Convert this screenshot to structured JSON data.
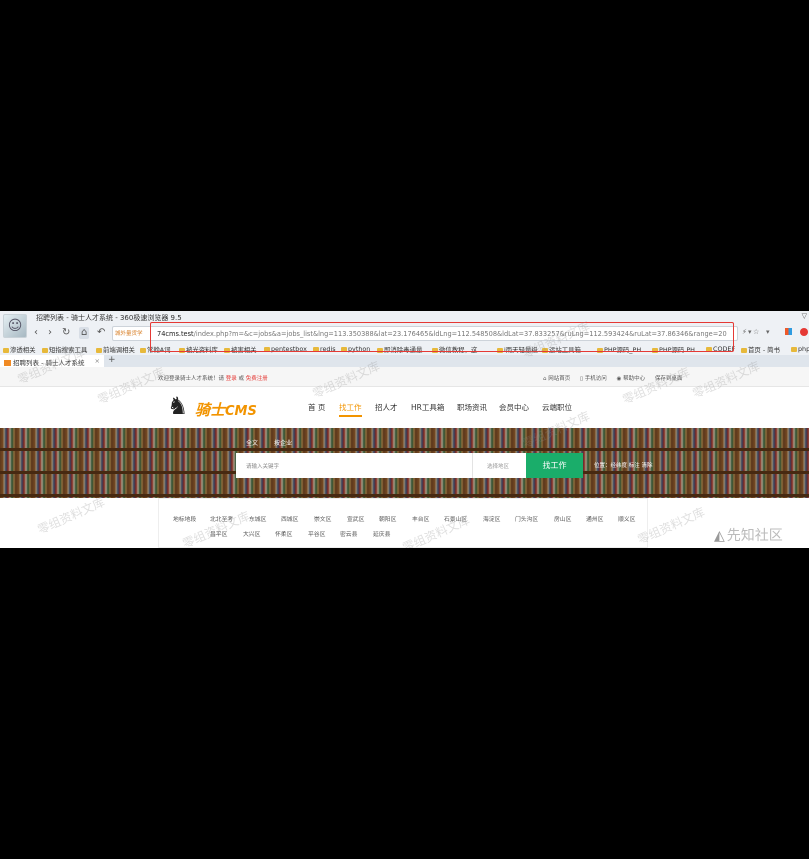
{
  "window": {
    "title": "招聘列表 - 骑士人才系统 - 360极速浏览器 9.5",
    "controls": "▽"
  },
  "toolbar": {
    "address_tag": "城外量货学",
    "url_host": "74cms.test",
    "url_path": "/index.php?m=&c=jobs&a=jobs_list&lng=113.350388&lat=23.176465&ldLng=112.548508&ldLat=37.833257&ruLng=112.593424&ruLat=37.86346&range=20",
    "right_icons": [
      "⚡",
      "▾",
      "☆",
      "▾"
    ]
  },
  "bookmarks": [
    "渗透相关",
    "短指搜索工具",
    "前端调相关",
    "常翰A词",
    "被光资料库",
    "被害相关",
    "pentestbox",
    "redis",
    "python",
    "即消除毒通量",
    "微信教程，这",
    "i雨天轻量级",
    "运站工具箱",
    "PHP源码_PH",
    "PHP源码 PH",
    "CODEF",
    "首页 - 简书",
    "php"
  ],
  "tab": {
    "title": "招聘列表 - 骑士人才系统",
    "close": "×",
    "new": "+"
  },
  "page": {
    "welcome": "欢迎登录骑士人才系统！请",
    "login": "登录",
    "or": "或",
    "register": "免费注册",
    "top_links": [
      "网站首页",
      "手机访问",
      "帮助中心",
      "保存到桌面"
    ],
    "logo_text": "骑士",
    "logo_cms": "CMS",
    "nav": [
      "首 页",
      "找工作",
      "招人才",
      "HR工具箱",
      "职场资讯",
      "会员中心",
      "云端职位"
    ],
    "search_tabs": [
      "全文",
      "按企业"
    ],
    "search_placeholder": "请输入关键字",
    "location_placeholder": "选择地区",
    "search_button": "找工作",
    "position_label": "位置：经纬度",
    "position_values": "标注 清除",
    "district_row1": [
      "地标地段",
      "北北至考",
      "东城区",
      "西城区",
      "崇文区",
      "宣武区",
      "朝阳区",
      "丰台区",
      "石景山区",
      "海淀区",
      "门头沟区",
      "房山区",
      "通州区",
      "顺义区"
    ],
    "district_row2": [
      "昌平区",
      "大兴区",
      "怀柔区",
      "平谷区",
      "密云县",
      "延庆县"
    ]
  },
  "watermark": {
    "text": "零组资料文库",
    "site_logo": "先知社区"
  }
}
